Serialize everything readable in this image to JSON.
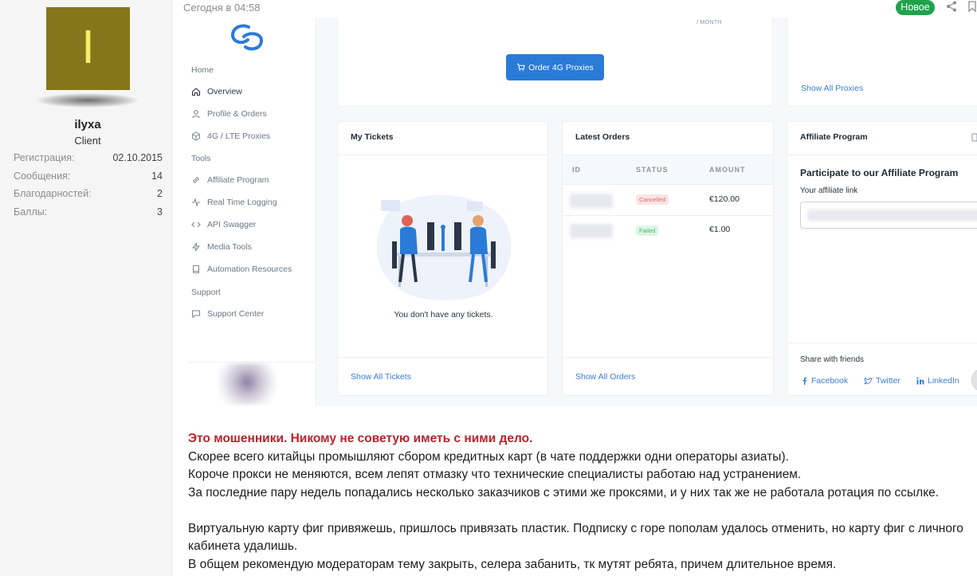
{
  "user": {
    "avatar_letter": "I",
    "name": "ilyxa",
    "role": "Client",
    "stats": [
      {
        "label": "Регистрация:",
        "value": "02.10.2015"
      },
      {
        "label": "Сообщения:",
        "value": "14"
      },
      {
        "label": "Благодарностей:",
        "value": "2"
      },
      {
        "label": "Баллы:",
        "value": "3"
      }
    ]
  },
  "post": {
    "date": "Сегодня в 04:58",
    "badge": "Новое",
    "lines": {
      "warning": "Это мошенники. Никому не советую иметь с ними дело.",
      "l1": "Скорее всего китайцы промышляют сбором кредитных карт (в чате поддержки одни операторы азиаты).",
      "l2": "Короче прокси не меняются, всем лепят отмазку что технические специалисты работаю над устранением.",
      "l3": "За последние пару недель попадались несколько заказчиков с этими же проксями, и у них так же не работала ротация по ссылке.",
      "l4": "Виртуальную карту фиг привяжешь, пришлось привязать пластик. Подписку с горе пополам удалось отменить, но карту фиг с личного",
      "l5": "кабинета удалишь.",
      "l6": "В общем рекомендую модераторам тему закрыть, селера забанить, тк мутят ребята, причем длительное время."
    }
  },
  "screenshot": {
    "nav": {
      "home": "Home",
      "overview": "Overview",
      "profile": "Profile & Orders",
      "proxies": "4G / LTE Proxies",
      "tools": "Tools",
      "affiliate": "Affiliate Program",
      "logging": "Real Time Logging",
      "swagger": "API Swagger",
      "media": "Media Tools",
      "automation": "Automation Resources",
      "support": "Support",
      "support_center": "Support Center"
    },
    "per_month": "/ MONTH",
    "order_button": "Order 4G Proxies",
    "show_all_proxies": "Show All Proxies",
    "tickets": {
      "title": "My Tickets",
      "empty": "You don't have any tickets.",
      "link": "Show All Tickets"
    },
    "orders": {
      "title": "Latest Orders",
      "columns": [
        "ID",
        "STATUS",
        "AMOUNT"
      ],
      "rows": [
        {
          "status": "Cancelled",
          "amount": "€120.00"
        },
        {
          "status": "Failed",
          "amount": "€1.00"
        }
      ],
      "link": "Show All Orders"
    },
    "affiliate": {
      "title": "Affiliate Program",
      "heading": "Participate to our Affiliate Program",
      "label": "Your affiliate link",
      "share": "Share with friends",
      "facebook": "Facebook",
      "twitter": "Twitter",
      "linkedin": "LinkedIn"
    }
  },
  "colors": {
    "accent": "#2a7bd8",
    "link": "#3b7ed4",
    "badge_new": "#1fa24a",
    "warning_text": "#b8242a",
    "avatar_bg": "#85761c"
  }
}
